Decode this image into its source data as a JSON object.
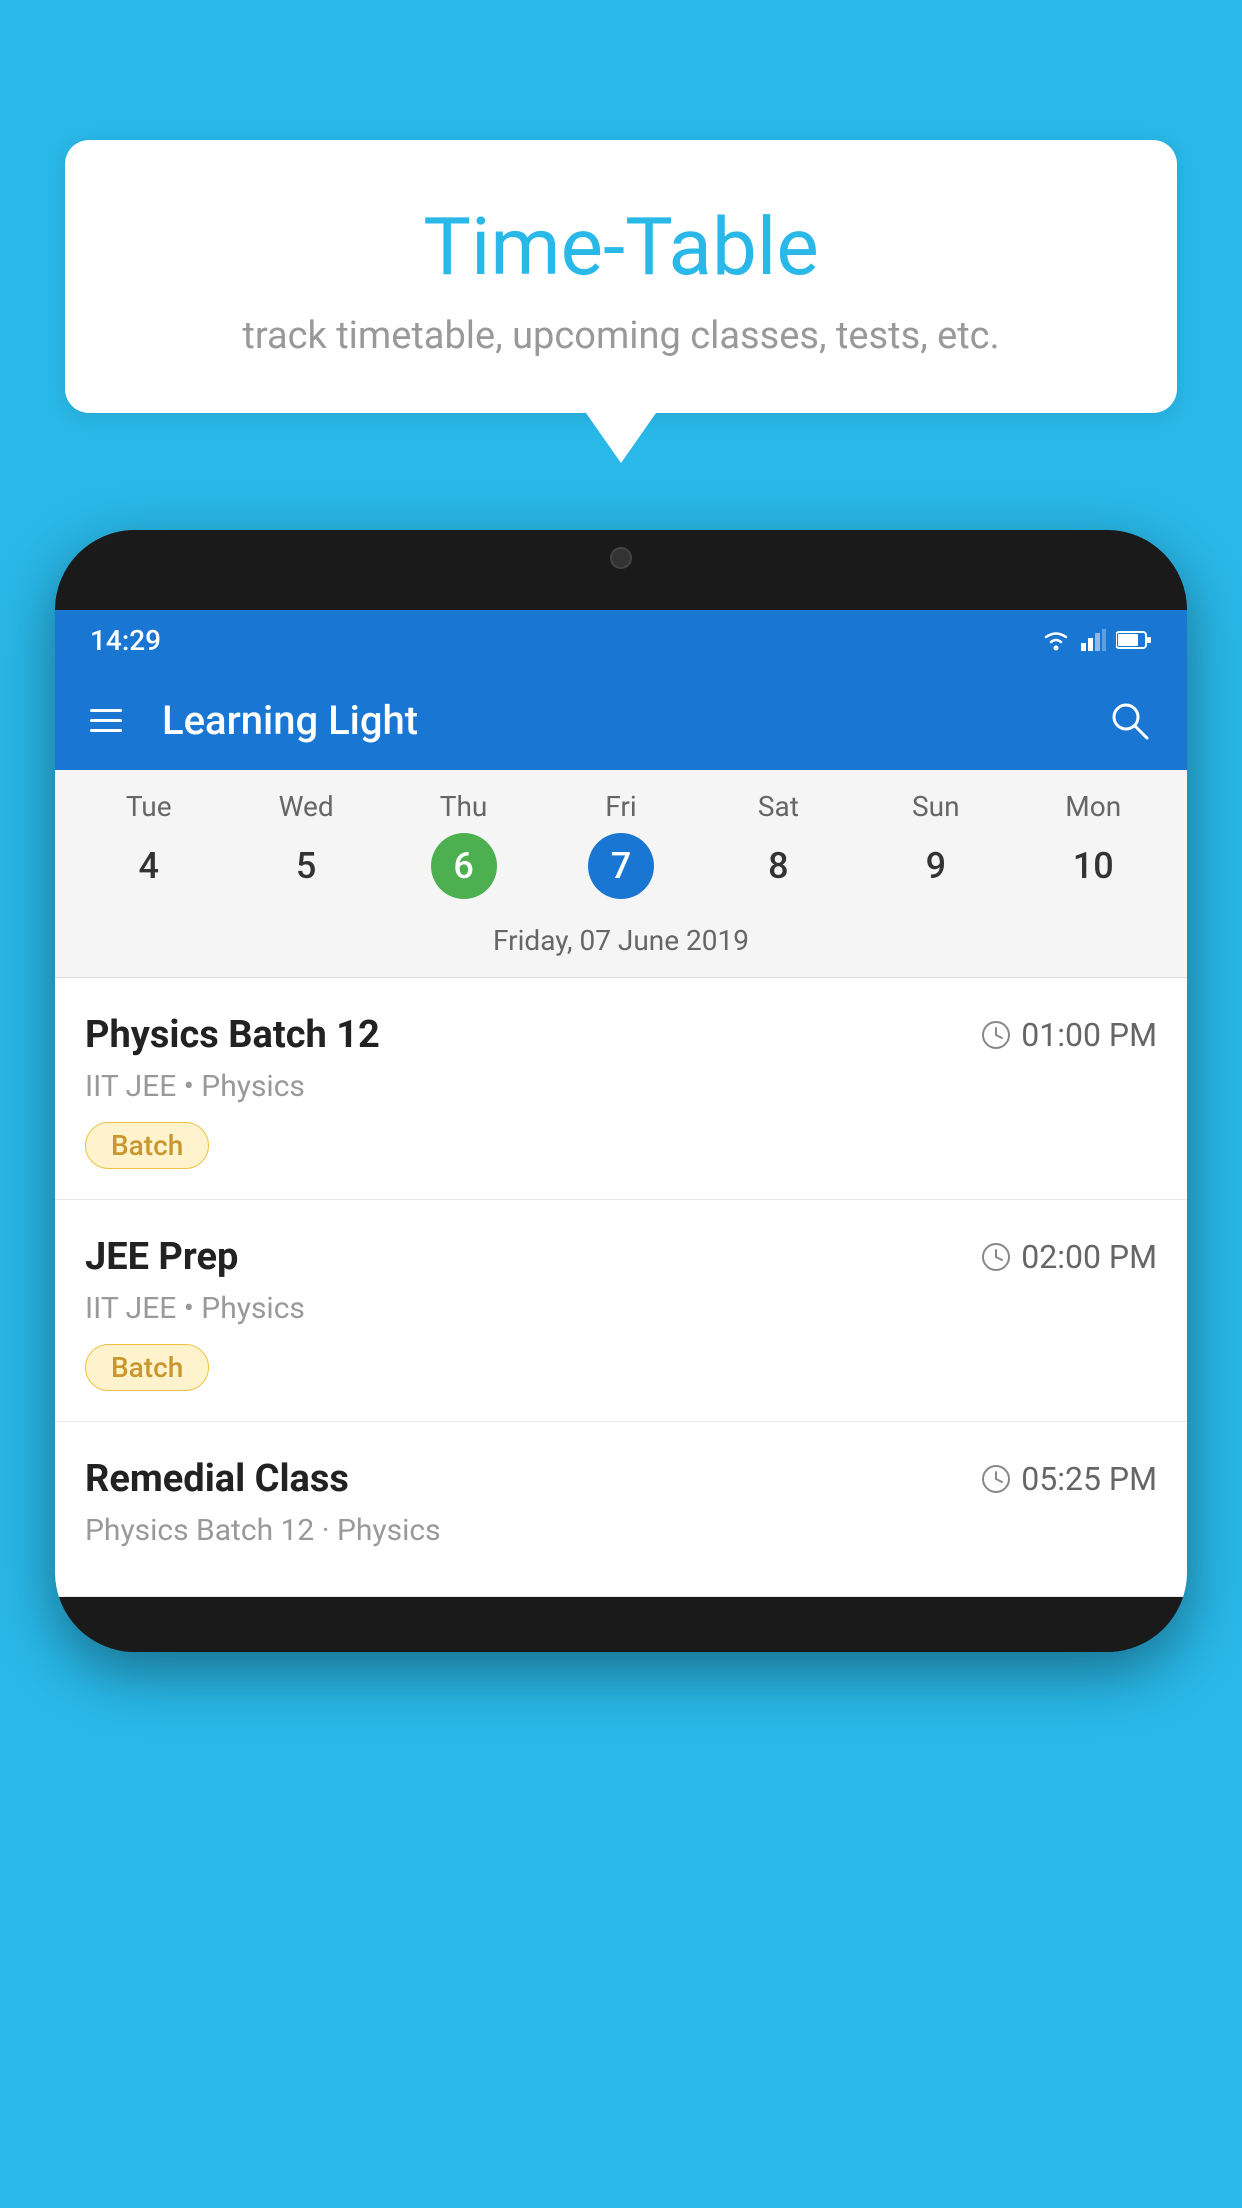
{
  "background_color": "#29b8e8",
  "speech_bubble": {
    "title": "Time-Table",
    "subtitle": "track timetable, upcoming classes, tests, etc."
  },
  "phone": {
    "status_bar": {
      "time": "14:29"
    },
    "app_bar": {
      "title": "Learning Light"
    },
    "calendar": {
      "days": [
        {
          "name": "Tue",
          "number": "4",
          "state": "normal"
        },
        {
          "name": "Wed",
          "number": "5",
          "state": "normal"
        },
        {
          "name": "Thu",
          "number": "6",
          "state": "today"
        },
        {
          "name": "Fri",
          "number": "7",
          "state": "selected"
        },
        {
          "name": "Sat",
          "number": "8",
          "state": "normal"
        },
        {
          "name": "Sun",
          "number": "9",
          "state": "normal"
        },
        {
          "name": "Mon",
          "number": "10",
          "state": "normal"
        }
      ],
      "selected_date_label": "Friday, 07 June 2019"
    },
    "schedule": [
      {
        "title": "Physics Batch 12",
        "time": "01:00 PM",
        "subtitle": "IIT JEE • Physics",
        "badge": "Batch"
      },
      {
        "title": "JEE Prep",
        "time": "02:00 PM",
        "subtitle": "IIT JEE • Physics",
        "badge": "Batch"
      },
      {
        "title": "Remedial Class",
        "time": "05:25 PM",
        "subtitle": "Physics Batch 12 · Physics",
        "badge": null
      }
    ]
  }
}
